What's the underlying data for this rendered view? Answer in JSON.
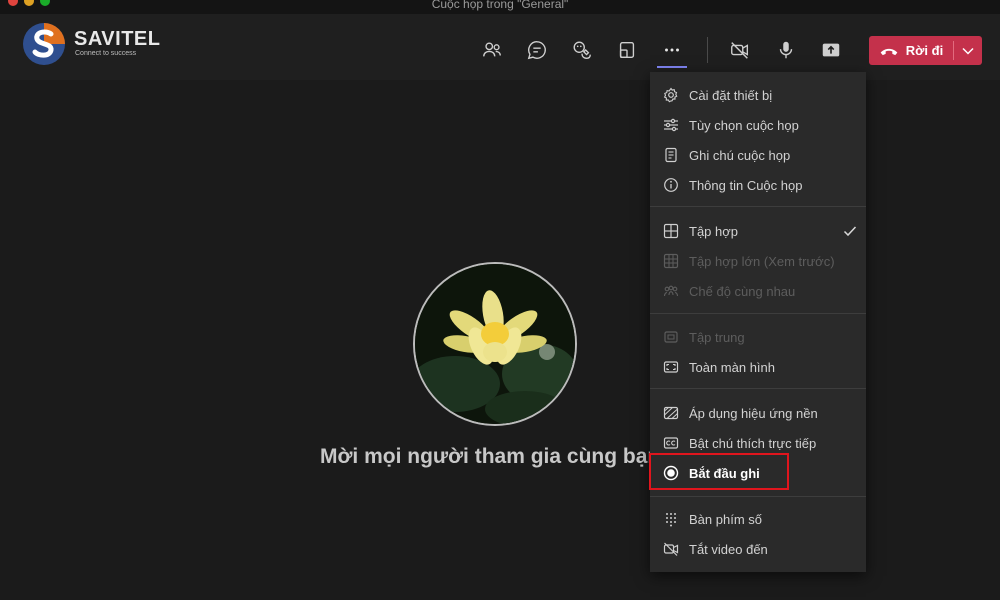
{
  "window": {
    "title": "Cuộc họp trong \"General\""
  },
  "logo": {
    "name": "SAVITEL",
    "tagline": "Connect to success"
  },
  "toolbar": {
    "buttons": [
      {
        "icon": "participants-icon"
      },
      {
        "icon": "chat-icon"
      },
      {
        "icon": "reactions-icon"
      },
      {
        "icon": "rooms-icon"
      },
      {
        "icon": "more-options-icon",
        "active": true
      },
      {
        "icon": "camera-off-icon"
      },
      {
        "icon": "microphone-icon"
      },
      {
        "icon": "share-screen-icon"
      }
    ],
    "leave_label": "Rời đi"
  },
  "stage": {
    "invite_text": "Mời mọi người tham gia cùng bạn"
  },
  "menu": {
    "items": [
      {
        "label": "Cài đặt thiết bị",
        "icon": "gear-icon",
        "enabled": true
      },
      {
        "label": "Tùy chọn cuộc họp",
        "icon": "sliders-icon",
        "enabled": true
      },
      {
        "label": "Ghi chú cuộc họp",
        "icon": "notes-icon",
        "enabled": true
      },
      {
        "label": "Thông tin Cuộc họp",
        "icon": "info-icon",
        "enabled": true
      },
      {
        "label": "Tập hợp",
        "icon": "gallery-icon",
        "enabled": true,
        "checked": true
      },
      {
        "label": "Tập hợp lớn (Xem trước)",
        "icon": "large-gallery-icon",
        "enabled": false
      },
      {
        "label": "Chế độ cùng nhau",
        "icon": "together-mode-icon",
        "enabled": false
      },
      {
        "label": "Tập trung",
        "icon": "focus-icon",
        "enabled": false
      },
      {
        "label": "Toàn màn hình",
        "icon": "fullscreen-icon",
        "enabled": true
      },
      {
        "label": "Áp dụng hiệu ứng nền",
        "icon": "background-effects-icon",
        "enabled": true
      },
      {
        "label": "Bật chú thích trực tiếp",
        "icon": "captions-icon",
        "enabled": true
      },
      {
        "label": "Bắt đầu ghi",
        "icon": "record-icon",
        "enabled": true,
        "highlighted": true
      },
      {
        "label": "Bàn phím số",
        "icon": "dialpad-icon",
        "enabled": true
      },
      {
        "label": "Tắt video đến",
        "icon": "incoming-video-off-icon",
        "enabled": true
      }
    ]
  },
  "colors": {
    "background": "#1b1b1b",
    "menu_background": "#2a2a2a",
    "leave_button": "#c4314b",
    "highlight_border": "#e0151d",
    "active_underline": "#7f85f5"
  }
}
